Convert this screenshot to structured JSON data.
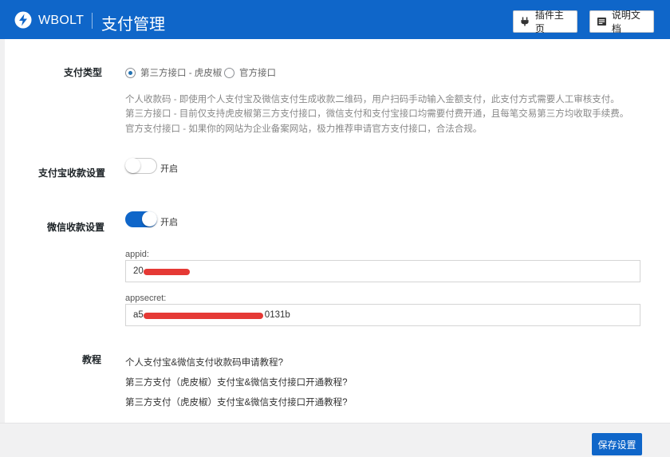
{
  "header": {
    "brand": "WBOLT",
    "title": "支付管理",
    "plugin_home_label": "插件主页",
    "docs_label": "说明文档",
    "color": "#0f66c9"
  },
  "payment_type": {
    "label": "支付类型",
    "options": [
      {
        "label": "第三方接口 - 虎皮椒",
        "selected": true
      },
      {
        "label": "官方接口",
        "selected": false
      }
    ],
    "descriptions": [
      "个人收款码 - 即使用个人支付宝及微信支付生成收款二维码，用户扫码手动输入金额支付，此支付方式需要人工审核支付。",
      "第三方接口 - 目前仅支持虎皮椒第三方支付接口，微信支付和支付宝接口均需要付费开通，且每笔交易第三方均收取手续费。",
      "官方支付接口 - 如果你的网站为企业备案网站，极力推荐申请官方支付接口，合法合规。"
    ]
  },
  "alipay": {
    "label": "支付宝收款设置",
    "toggle_label": "开启",
    "enabled": false
  },
  "wechat": {
    "label": "微信收款设置",
    "toggle_label": "开启",
    "enabled": true,
    "appid_label": "appid:",
    "appid_value": "20",
    "appsecret_label": "appsecret:",
    "appsecret_prefix": "a5",
    "appsecret_suffix": "0131b"
  },
  "tutorial": {
    "label": "教程",
    "links": [
      "个人支付宝&微信支付收款码申请教程?",
      "第三方支付（虎皮椒）支付宝&微信支付接口开通教程?",
      "第三方支付（虎皮椒）支付宝&微信支付接口开通教程?"
    ]
  },
  "footer": {
    "save_label": "保存设置"
  }
}
